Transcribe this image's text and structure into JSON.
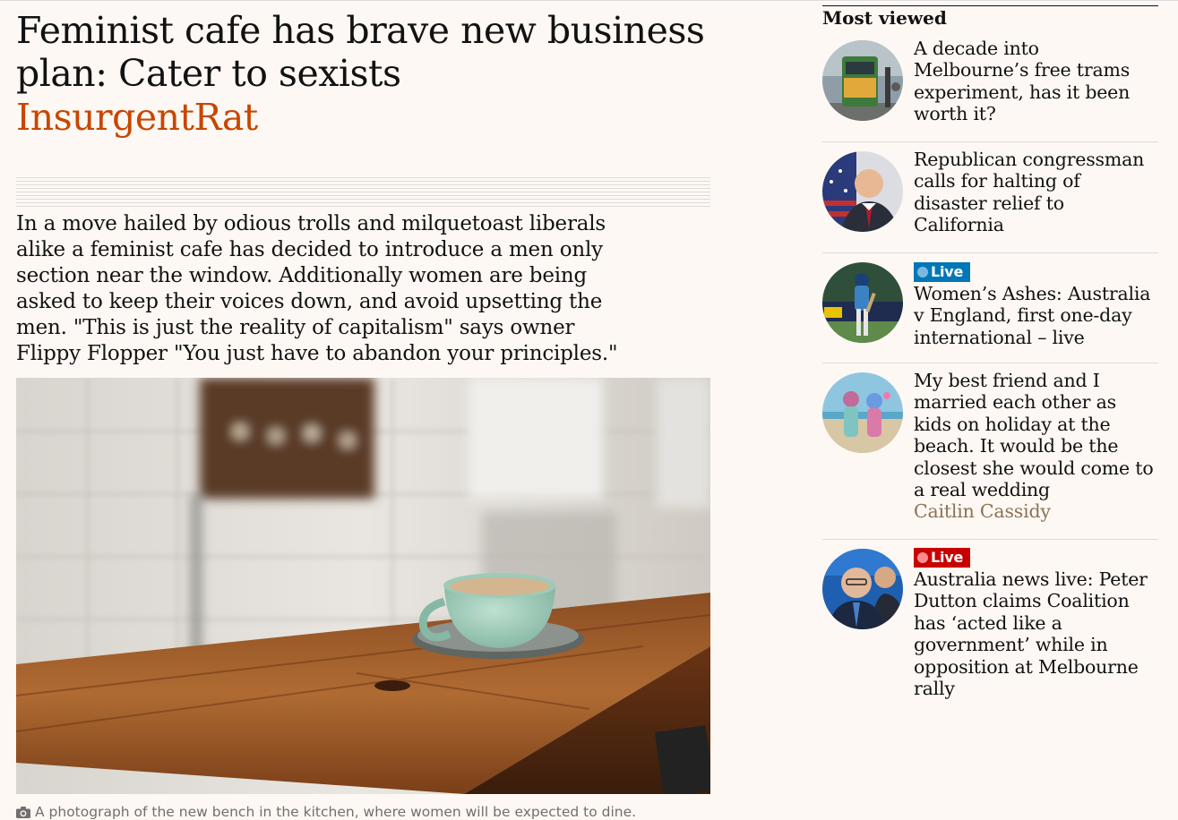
{
  "article": {
    "headline": "Feminist cafe has brave new business plan: Cater to sexists",
    "byline": "InsurgentRat",
    "standfirst": "In a move hailed by odious trolls and milquetoast liberals alike a feminist cafe has decided to introduce a men only section near the window. Additionally women are being asked to keep their voices down, and avoid upsetting the men. \"This is just the reality of capitalism\" says owner Flippy Flopper \"You just have to abandon your principles.\"",
    "image_caption": "A photograph of the new bench in the kitchen, where women will be expected to dine.",
    "caption_icon": "camera-icon"
  },
  "most_viewed": {
    "heading": "Most viewed",
    "items": [
      {
        "live": "",
        "title": "A decade into Melbourne’s free trams experiment, has it been worth it?",
        "author": ""
      },
      {
        "live": "",
        "title": "Republican congressman calls for halting of disaster relief to California",
        "author": ""
      },
      {
        "live": "Live",
        "title": "Women’s Ashes: Australia v England, first one-day international – live",
        "author": ""
      },
      {
        "live": "",
        "title": "My best friend and I married each other as kids on holiday at the beach. It would be the closest she would come to a real wedding",
        "author": "Caitlin Cassidy"
      },
      {
        "live": "Live",
        "title": "Australia news live: Peter Dutton claims Coalition has ‘acted like a government’ while in opposition at Melbourne rally",
        "author": ""
      }
    ]
  },
  "colors": {
    "background": "#fdf8f3",
    "byline": "#c74600",
    "live_blue": "#0077b6",
    "live_red": "#c70000",
    "author": "#8b7355"
  }
}
